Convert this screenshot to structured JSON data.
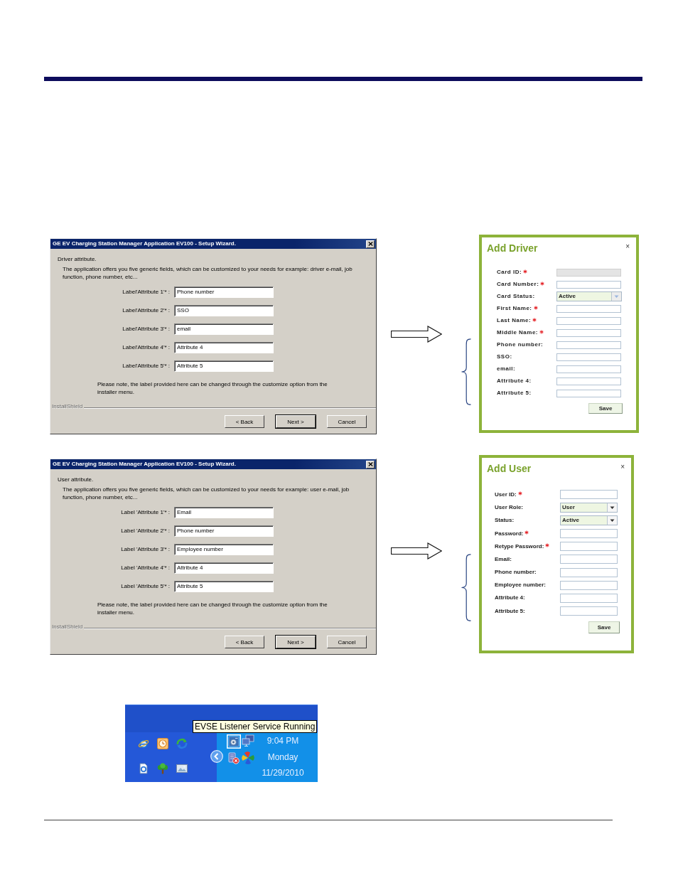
{
  "steps": [
    {
      "wizard": {
        "title": "GE EV Charging Station Manager Application EV100 - Setup Wizard.",
        "heading": "Driver attribute.",
        "description": "The application offers you five generic fields, which can be customized to your needs for example: driver e-mail, job function, phone number, etc...",
        "fields": [
          {
            "label": "Label'Attribute 1'* :",
            "value": "Phone number"
          },
          {
            "label": "Label'Attribute 2'* :",
            "value": "SSO"
          },
          {
            "label": "Label'Attribute 3'* :",
            "value": "email"
          },
          {
            "label": "Label'Attribute 4'* :",
            "value": "Attribute 4"
          },
          {
            "label": "Label'Attribute 5'* :",
            "value": "Attribute 5"
          }
        ],
        "note": "Please note, the label provided here can be changed through the customize option from the installer menu.",
        "brand": "InstallShield",
        "buttons": [
          {
            "label": "< Back",
            "default": false
          },
          {
            "label": "Next >",
            "default": true
          },
          {
            "label": "Cancel",
            "default": false
          }
        ]
      },
      "form": {
        "title": "Add Driver",
        "close": "×",
        "fields": [
          {
            "label": "Card ID:",
            "required": true,
            "kind": "text",
            "disabled": true
          },
          {
            "label": "Card Number:",
            "required": true,
            "kind": "text",
            "disabled": false
          },
          {
            "label": "Card Status:",
            "required": false,
            "kind": "select",
            "value": "Active",
            "disabled": false
          },
          {
            "label": "First Name:",
            "required": true,
            "kind": "text",
            "disabled": false
          },
          {
            "label": "Last Name:",
            "required": true,
            "kind": "text",
            "disabled": false
          },
          {
            "label": "Middle Name:",
            "required": true,
            "kind": "text",
            "disabled": false
          },
          {
            "label": "Phone number:",
            "required": false,
            "kind": "text",
            "disabled": false
          },
          {
            "label": "SSO:",
            "required": false,
            "kind": "text",
            "disabled": false
          },
          {
            "label": "email:",
            "required": false,
            "kind": "text",
            "disabled": false
          },
          {
            "label": "Attribute 4:",
            "required": false,
            "kind": "text",
            "disabled": false
          },
          {
            "label": "Attribute 5:",
            "required": false,
            "kind": "text",
            "disabled": false
          }
        ],
        "save": "Save"
      }
    },
    {
      "wizard": {
        "title": "GE EV Charging Station Manager Application EV100 - Setup Wizard.",
        "heading": "User attribute.",
        "description": "The application offers you five generic fields, which can be customized to your needs for example: user e-mail, job function, phone number, etc...",
        "fields": [
          {
            "label": "Label 'Attribute 1'* :",
            "value": "Email"
          },
          {
            "label": "Label 'Attribute 2'* :",
            "value": "Phone number"
          },
          {
            "label": "Label 'Attribute 3'* :",
            "value": "Employee number"
          },
          {
            "label": "Label 'Attribute 4'* :",
            "value": "Attribute 4"
          },
          {
            "label": "Label 'Attribute 5'* :",
            "value": "Attribute 5"
          }
        ],
        "note": "Please note, the label provided here can be changed through the customize option from the installer menu.",
        "brand": "InstallShield",
        "buttons": [
          {
            "label": "< Back",
            "default": false
          },
          {
            "label": "Next >",
            "default": true
          },
          {
            "label": "Cancel",
            "default": false
          }
        ]
      },
      "form": {
        "title": "Add User",
        "close": "×",
        "fields": [
          {
            "label": "User ID:",
            "required": true,
            "kind": "text",
            "disabled": false
          },
          {
            "label": "User Role:",
            "required": false,
            "kind": "select",
            "value": "User",
            "disabled": false
          },
          {
            "label": "Status:",
            "required": false,
            "kind": "select",
            "value": "Active",
            "disabled": false
          },
          {
            "label": "Password:",
            "required": true,
            "kind": "text",
            "disabled": false
          },
          {
            "label": "Retype Password:",
            "required": true,
            "kind": "text",
            "disabled": false
          },
          {
            "label": "Email:",
            "required": false,
            "kind": "text",
            "disabled": false
          },
          {
            "label": "Phone number:",
            "required": false,
            "kind": "text",
            "disabled": false
          },
          {
            "label": "Employee number:",
            "required": false,
            "kind": "text",
            "disabled": false
          },
          {
            "label": "Attribute 4:",
            "required": false,
            "kind": "text",
            "disabled": false
          },
          {
            "label": "Attribute 5:",
            "required": false,
            "kind": "text",
            "disabled": false
          }
        ],
        "save": "Save"
      }
    }
  ],
  "tray": {
    "tooltip": "EVSE Listener Service Running",
    "icon_highlighted": true,
    "time": "9:04 PM",
    "day": "Monday",
    "date": "11/29/2010"
  }
}
